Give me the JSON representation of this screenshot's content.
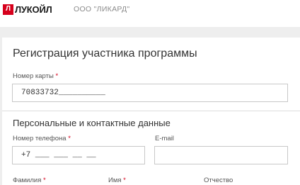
{
  "header": {
    "brand": "ЛУКОЙЛ",
    "company": "ООО \"ЛИКАРД\""
  },
  "form": {
    "title": "Регистрация участника программы",
    "card_number": {
      "label": "Номер карты",
      "required": "*",
      "value": "70833732__________"
    },
    "section_title": "Персональные и контактные данные",
    "phone": {
      "label": "Номер телефона",
      "required": "*",
      "value": "+7 ___ ___ __ __"
    },
    "email": {
      "label": "E-mail",
      "value": ""
    },
    "surname": {
      "label": "Фамилия",
      "required": "*"
    },
    "name": {
      "label": "Имя",
      "required": "*"
    },
    "patronymic": {
      "label": "Отчество"
    }
  }
}
